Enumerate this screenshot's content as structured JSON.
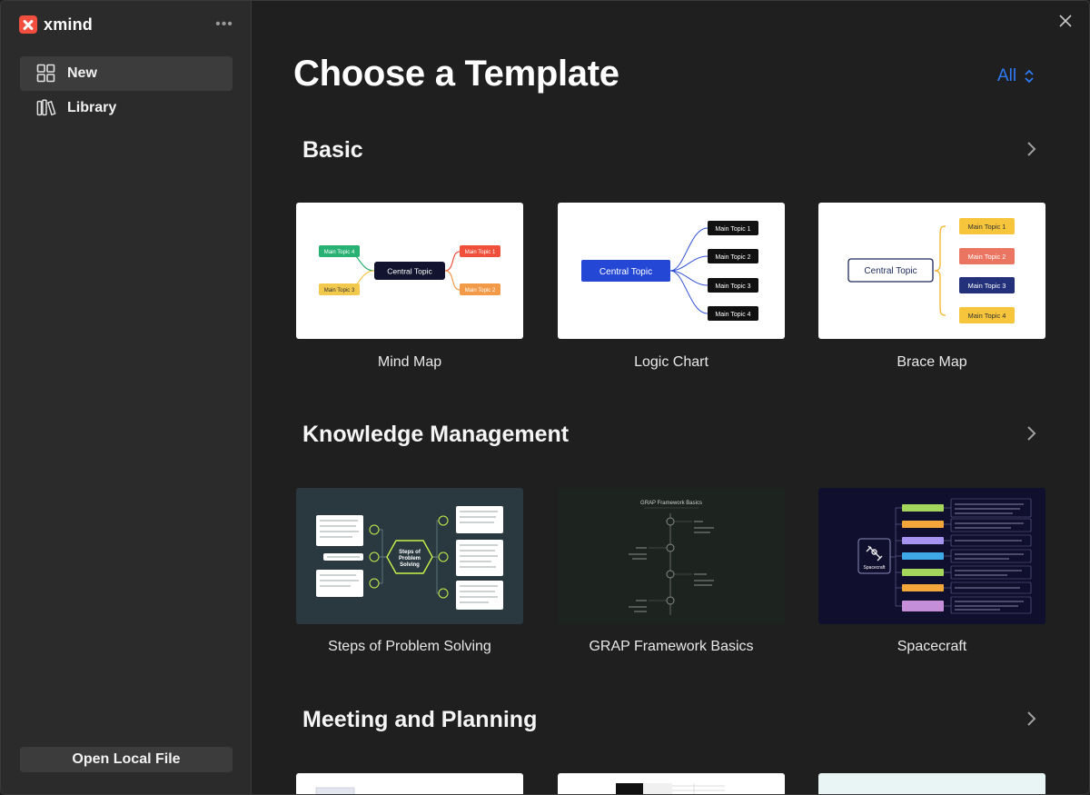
{
  "app": {
    "name": "xmind"
  },
  "sidebar": {
    "more_label": "•••",
    "items": [
      {
        "label": "New",
        "icon": "grid-icon",
        "active": true
      },
      {
        "label": "Library",
        "icon": "library-icon",
        "active": false
      }
    ],
    "open_local_file": "Open Local File"
  },
  "main": {
    "title": "Choose a Template",
    "filter": {
      "value": "All"
    },
    "sections": [
      {
        "title": "Basic",
        "templates": [
          {
            "label": "Mind Map",
            "preview": {
              "central": "Central Topic",
              "topics": [
                "Main Topic 1",
                "Main Topic 2",
                "Main Topic 3",
                "Main Topic 4"
              ]
            }
          },
          {
            "label": "Logic Chart",
            "preview": {
              "central": "Central Topic",
              "topics": [
                "Main Topic 1",
                "Main Topic 2",
                "Main Topic 3",
                "Main Topic 4"
              ]
            }
          },
          {
            "label": "Brace Map",
            "preview": {
              "central": "Central Topic",
              "topics": [
                "Main Topic 1",
                "Main Topic 2",
                "Main Topic 3",
                "Main Topic 4"
              ]
            }
          }
        ]
      },
      {
        "title": "Knowledge Management",
        "templates": [
          {
            "label": "Steps of Problem Solving",
            "preview": {
              "central": "Steps of Problem Solving"
            }
          },
          {
            "label": "GRAP Framework Basics",
            "preview": {
              "title": "GRAP Framework Basics"
            }
          },
          {
            "label": "Spacecraft",
            "preview": {
              "central": "Spacecraft"
            }
          }
        ]
      },
      {
        "title": "Meeting and Planning",
        "templates": [
          {
            "label": ""
          },
          {
            "label": ""
          },
          {
            "label": ""
          }
        ]
      }
    ]
  },
  "colors": {
    "accent": "#2f7bf5",
    "brand": "#f04e3e",
    "sidebar_bg": "#2b2b2b",
    "main_bg": "#1f1f1f"
  }
}
